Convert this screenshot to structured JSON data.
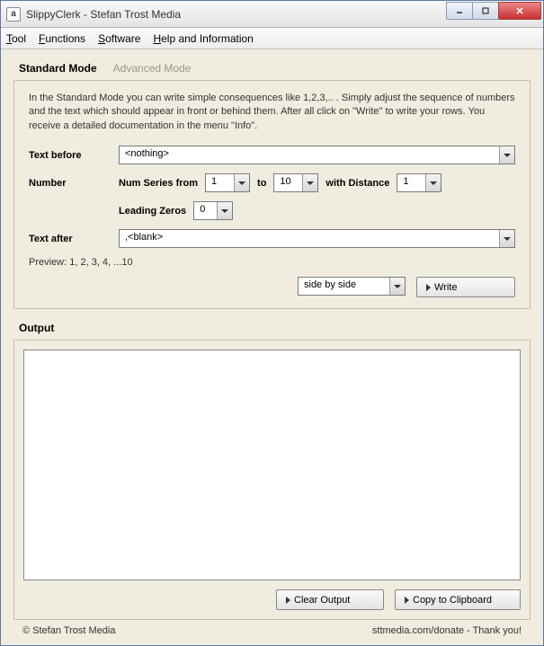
{
  "title": "SlippyClerk - Stefan Trost Media",
  "menu": {
    "tool": "Tool",
    "functions": "Functions",
    "software": "Software",
    "help": "Help and Information"
  },
  "tabs": {
    "standard": "Standard Mode",
    "advanced": "Advanced Mode"
  },
  "description": "In the Standard Mode you can write simple consequences like 1,2,3,.. . Simply adjust the sequence of numbers and the text which should appear in front or behind them. After all click on \"Write\" to write your rows. You receive a detailed documentation in the menu \"Info\".",
  "form": {
    "text_before_label": "Text before",
    "text_before_value": "<nothing>",
    "number_label": "Number",
    "num_series_label": "Num Series from",
    "num_from": "1",
    "to_label": "to",
    "num_to": "10",
    "distance_label": "with Distance",
    "distance": "1",
    "leading_zeros_label": "Leading Zeros",
    "leading_zeros": "0",
    "text_after_label": "Text after",
    "text_after_value": ",<blank>"
  },
  "preview": "Preview: 1, 2, 3, 4, ...10",
  "layout_mode": "side by side",
  "write_button": "Write",
  "output_label": "Output",
  "output_value": "",
  "clear_button": "Clear Output",
  "copy_button": "Copy to Clipboard",
  "footer_left": "© Stefan Trost Media",
  "footer_right": "sttmedia.com/donate - Thank you!"
}
